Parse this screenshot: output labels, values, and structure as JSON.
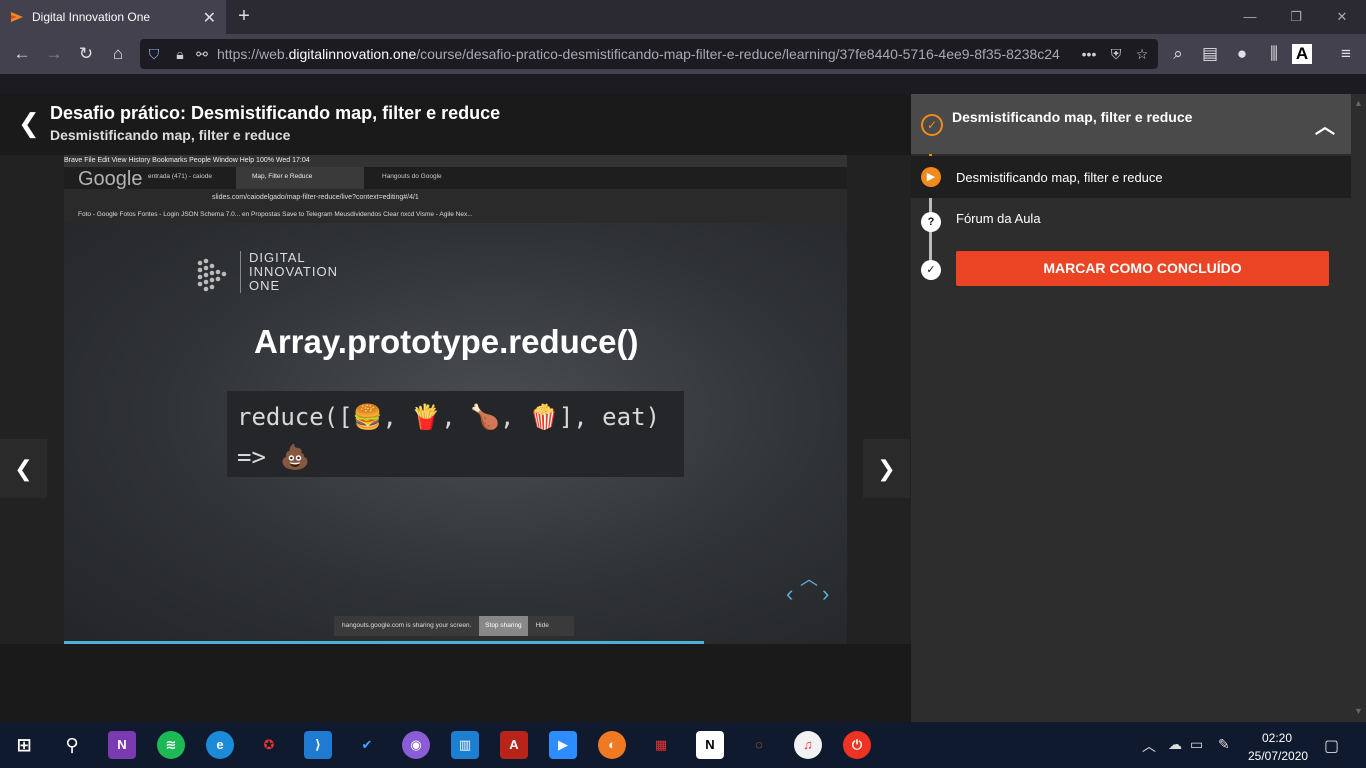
{
  "browser": {
    "tab_title": "Digital Innovation One",
    "tab_close": "✕",
    "new_tab": "+",
    "url_prefix": "https://web.",
    "url_domain": "digitalinnovation.one",
    "url_path": "/course/desafio-pratico-desmistificando-map-filter-e-reduce/learning/37fe8440-5716-4ee9-8f35-8238c24",
    "url_more": "•••"
  },
  "header": {
    "title": "Desafio prático: Desmistificando map, filter e reduce",
    "subtitle": "Desmistificando map, filter e reduce"
  },
  "video": {
    "mac_menu": "  Brave   File   Edit   View   History   Bookmarks   People   Window   Help                                                                                                       100%   Wed 17:04",
    "mac_tab1": "entrada (471) - caiode",
    "mac_tab2": "Map, Filter e Reduce",
    "mac_tab3": "Hangouts do Google",
    "google_overlay": "Google",
    "mac_url": "slides.com/caiodelgado/map-filter-reduce/live?context=editing#/4/1",
    "mac_bookmarks": "Foto - Google Fotos    Fontes - Login    JSON Schema 7.0...    en    Propostas    Save to Telegram    Meusdividendos    Clear    nxcd    Visme - Agile Nex...",
    "logo_line1": "DIGITAL",
    "logo_line2": "INNOVATION",
    "logo_line3": "ONE",
    "slide_title": "Array.prototype.reduce()",
    "code_line1": "reduce([🍔, 🍟, 🍗, 🍿], eat)",
    "code_line2": "=> 💩",
    "share_text": "hangouts.google.com is sharing your screen.",
    "stop_sharing": "Stop sharing",
    "hide": "Hide"
  },
  "sidebar": {
    "module_title": "Desmistificando map, filter e reduce",
    "item_video": "Desmistificando map, filter e reduce",
    "item_forum": "Fórum da Aula",
    "complete_button": "MARCAR COMO CONCLUÍDO"
  },
  "taskbar": {
    "time": "02:20",
    "date": "25/07/2020"
  },
  "colors": {
    "accent_orange": "#f08a1c",
    "complete_red": "#ea4425",
    "progress_blue": "#4ab3d4"
  }
}
